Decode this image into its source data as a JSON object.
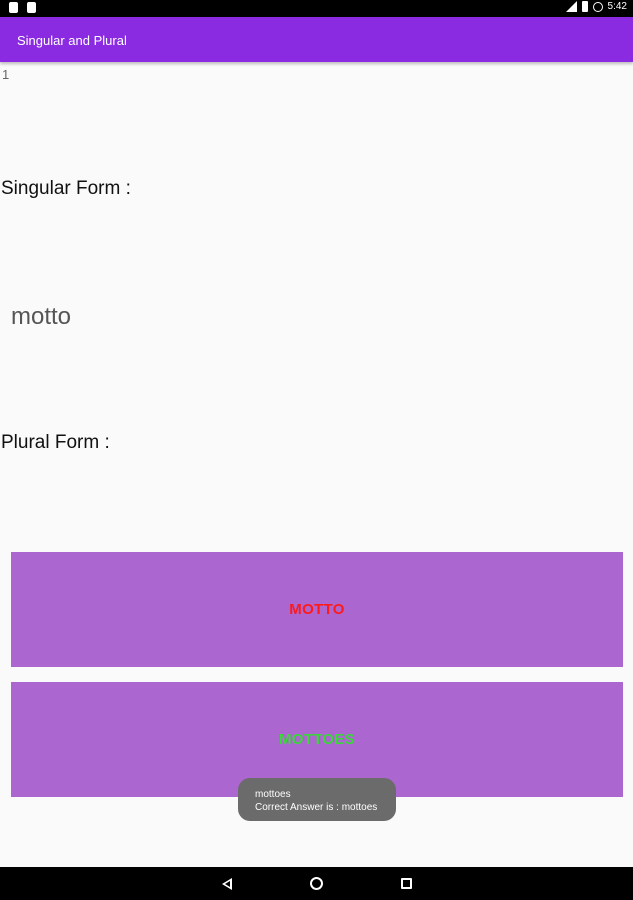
{
  "status_bar": {
    "time": "5:42",
    "notification_icons": [
      "android-notification-icon",
      "android-notification-icon"
    ],
    "system_icons": [
      "alarm-icon",
      "signal-icon",
      "battery-icon"
    ]
  },
  "app_bar": {
    "title": "Singular and Plural"
  },
  "quiz": {
    "question_number": "1",
    "singular_label": "Singular Form :",
    "singular_word": "motto",
    "plural_label": "Plural Form :",
    "options": [
      {
        "label": "MOTTO",
        "text_color": "#ff1a1a"
      },
      {
        "label": "MOTTOES",
        "text_color": "#3ad63a"
      }
    ]
  },
  "toast": {
    "line1": "mottoes",
    "line2": "Correct Answer is : mottoes"
  },
  "colors": {
    "app_bar": "#8a2be2",
    "option_background": "#ab66cf",
    "background": "#fafafa"
  },
  "nav_bar": {
    "icons": [
      "back-icon",
      "home-icon",
      "recents-icon"
    ]
  }
}
